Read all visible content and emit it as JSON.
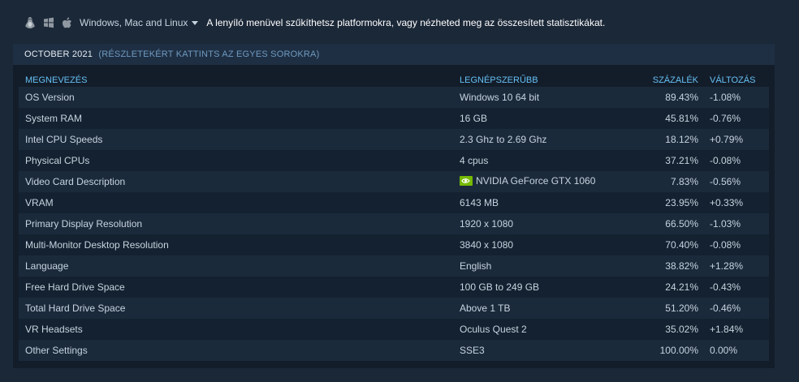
{
  "platforms": {
    "icons": [
      "linux-icon",
      "windows-icon",
      "apple-icon"
    ],
    "selected": "Windows, Mac and Linux",
    "description": "A lenyíló menüvel szűkíthetsz platformokra, vagy nézheted meg az összesített statisztikákat."
  },
  "panel": {
    "month": "OCTOBER 2021",
    "hint": "(RÉSZLETEKÉRT KATTINTS AZ EGYES SOROKRA)"
  },
  "table": {
    "headers": {
      "name": "MEGNEVEZÉS",
      "popular": "LEGNÉPSZERŰBB",
      "percent": "SZÁZALÉK",
      "change": "VÁLTOZÁS"
    },
    "rows": [
      {
        "name": "OS Version",
        "popular": "Windows 10 64 bit",
        "percent": "89.43%",
        "change": "-1.08%"
      },
      {
        "name": "System RAM",
        "popular": "16 GB",
        "percent": "45.81%",
        "change": "-0.76%"
      },
      {
        "name": "Intel CPU Speeds",
        "popular": "2.3 Ghz to 2.69 Ghz",
        "percent": "18.12%",
        "change": "+0.79%"
      },
      {
        "name": "Physical CPUs",
        "popular": "4 cpus",
        "percent": "37.21%",
        "change": "-0.08%"
      },
      {
        "name": "Video Card Description",
        "popular": "NVIDIA GeForce GTX 1060",
        "percent": "7.83%",
        "change": "-0.56%",
        "icon": "nvidia-icon"
      },
      {
        "name": "VRAM",
        "popular": "6143 MB",
        "percent": "23.95%",
        "change": "+0.33%"
      },
      {
        "name": "Primary Display Resolution",
        "popular": "1920 x 1080",
        "percent": "66.50%",
        "change": "-1.03%"
      },
      {
        "name": "Multi-Monitor Desktop Resolution",
        "popular": "3840 x 1080",
        "percent": "70.40%",
        "change": "-0.08%"
      },
      {
        "name": "Language",
        "popular": "English",
        "percent": "38.82%",
        "change": "+1.28%"
      },
      {
        "name": "Free Hard Drive Space",
        "popular": "100 GB to 249 GB",
        "percent": "24.21%",
        "change": "-0.43%"
      },
      {
        "name": "Total Hard Drive Space",
        "popular": "Above 1 TB",
        "percent": "51.20%",
        "change": "-0.46%"
      },
      {
        "name": "VR Headsets",
        "popular": "Oculus Quest 2",
        "percent": "35.02%",
        "change": "+1.84%"
      },
      {
        "name": "Other Settings",
        "popular": "SSE3",
        "percent": "100.00%",
        "change": "0.00%"
      }
    ]
  },
  "colors": {
    "background": "#1b2838",
    "positive": "#8ad624",
    "negative": "#e0552d",
    "header_blue": "#66c0f4"
  }
}
